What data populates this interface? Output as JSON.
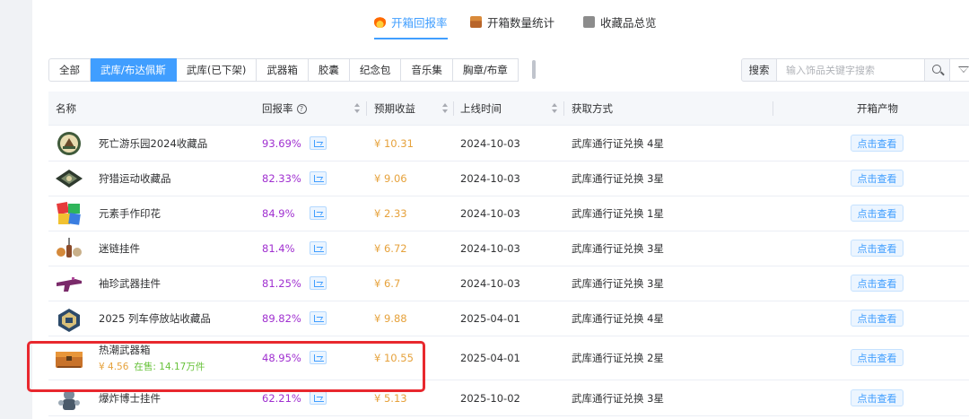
{
  "tabs": [
    {
      "label": "开箱回报率",
      "icon": "fire-icon",
      "active": true
    },
    {
      "label": "开箱数量统计",
      "icon": "box-icon",
      "active": false
    },
    {
      "label": "收藏品总览",
      "icon": "book-icon",
      "active": false
    }
  ],
  "filters": [
    "全部",
    "武库/布达佩斯",
    "武库(已下架)",
    "武器箱",
    "胶囊",
    "纪念包",
    "音乐集",
    "胸章/布章"
  ],
  "active_filter": "武库/布达佩斯",
  "search": {
    "label": "搜索",
    "placeholder": "输入饰品关键字搜索"
  },
  "columns": {
    "name": "名称",
    "ratio": "回报率",
    "profit": "预期收益",
    "date": "上线时间",
    "method": "获取方式",
    "products": "开箱产物"
  },
  "view_label": "点击查看",
  "rows": [
    {
      "name": "死亡游乐园2024收藏品",
      "ratio": "93.69%",
      "profit": "¥ 10.31",
      "date": "2024-10-03",
      "method": "武库通行证兑换 4星",
      "icon": "badge-emblem-icon"
    },
    {
      "name": "狩猎运动收藏品",
      "ratio": "82.33%",
      "profit": "¥ 9.06",
      "date": "2024-10-03",
      "method": "武库通行证兑换 3星",
      "icon": "diamond-emblem-icon"
    },
    {
      "name": "元素手作印花",
      "ratio": "84.9%",
      "profit": "¥ 2.33",
      "date": "2024-10-03",
      "method": "武库通行证兑换 1星",
      "icon": "sticker-icon"
    },
    {
      "name": "迷链挂件",
      "ratio": "81.4%",
      "profit": "¥ 6.72",
      "date": "2024-10-03",
      "method": "武库通行证兑换 3星",
      "icon": "charm-icon"
    },
    {
      "name": "袖珍武器挂件",
      "ratio": "81.25%",
      "profit": "¥ 6.7",
      "date": "2024-10-03",
      "method": "武库通行证兑换 3星",
      "icon": "gun-charm-icon"
    },
    {
      "name": "2025 列车停放站收藏品",
      "ratio": "89.82%",
      "profit": "¥ 9.88",
      "date": "2025-04-01",
      "method": "武库通行证兑换 4星",
      "icon": "train-emblem-icon"
    },
    {
      "name": "热潮武器箱",
      "sub_price": "¥ 4.56",
      "sub_onsale": "在售: 14.17万件",
      "ratio": "48.95%",
      "profit": "¥ 10.55",
      "date": "2025-04-01",
      "method": "武库通行证兑换 2星",
      "icon": "weapon-case-icon"
    },
    {
      "name": "爆炸博士挂件",
      "ratio": "62.21%",
      "profit": "¥ 5.13",
      "date": "2025-10-02",
      "method": "武库通行证兑换 3星",
      "icon": "figure-charm-icon"
    }
  ],
  "colors": {
    "accent": "#409eff",
    "ratio": "#a030d0",
    "profit": "#e6a23c",
    "onsale": "#67c23a",
    "highlight": "#e8282e"
  }
}
